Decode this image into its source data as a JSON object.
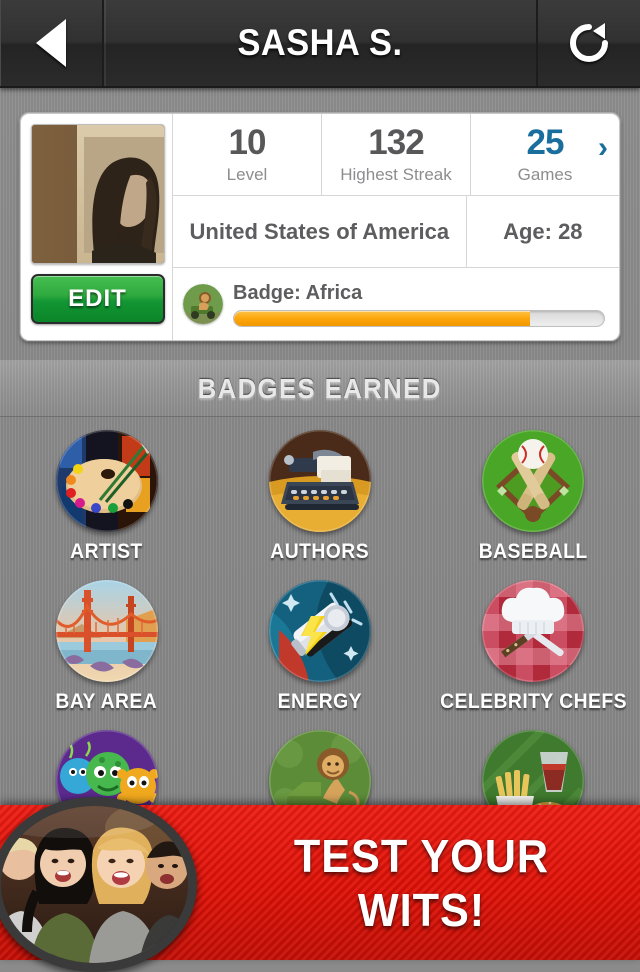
{
  "navbar": {
    "back_label": "Back",
    "title": "SASHA S.",
    "refresh_label": "Refresh"
  },
  "profile": {
    "avatar_alt": "Sepia photo of woman with long dark hair",
    "edit_label": "EDIT",
    "stats": [
      {
        "value": "10",
        "label": "Level",
        "accent": false
      },
      {
        "value": "132",
        "label": "Highest Streak",
        "accent": false
      },
      {
        "value": "25",
        "label": "Games",
        "accent": true
      }
    ],
    "chevron": "›",
    "country": "United States of America",
    "age": "Age: 28",
    "current_badge": "Badge: Africa",
    "progress_percent": 80
  },
  "badges_section": {
    "title": "BADGES EARNED",
    "badges": [
      {
        "label": "ARTIST",
        "icon": "palette-badge-icon"
      },
      {
        "label": "AUTHORS",
        "icon": "typewriter-badge-icon"
      },
      {
        "label": "BASEBALL",
        "icon": "baseball-badge-icon"
      },
      {
        "label": "BAY AREA",
        "icon": "golden-gate-badge-icon"
      },
      {
        "label": "ENERGY",
        "icon": "battery-badge-icon"
      },
      {
        "label": "CELEBRITY CHEFS",
        "icon": "chef-hat-badge-icon"
      },
      {
        "label": "",
        "icon": "monsters-badge-icon"
      },
      {
        "label": "",
        "icon": "lion-jeep-badge-icon"
      },
      {
        "label": "",
        "icon": "fast-food-badge-icon"
      }
    ]
  },
  "ad": {
    "headline": "TEST YOUR WITS!",
    "photo_alt": "Group of friends laughing"
  },
  "colors": {
    "accent_blue": "#1a6e9e",
    "edit_green": "#2faa3e",
    "progress_orange": "#fca70d",
    "ad_red": "#e01208",
    "background_gray": "#8a8a8a",
    "navbar_dark": "#2e2e2e"
  }
}
